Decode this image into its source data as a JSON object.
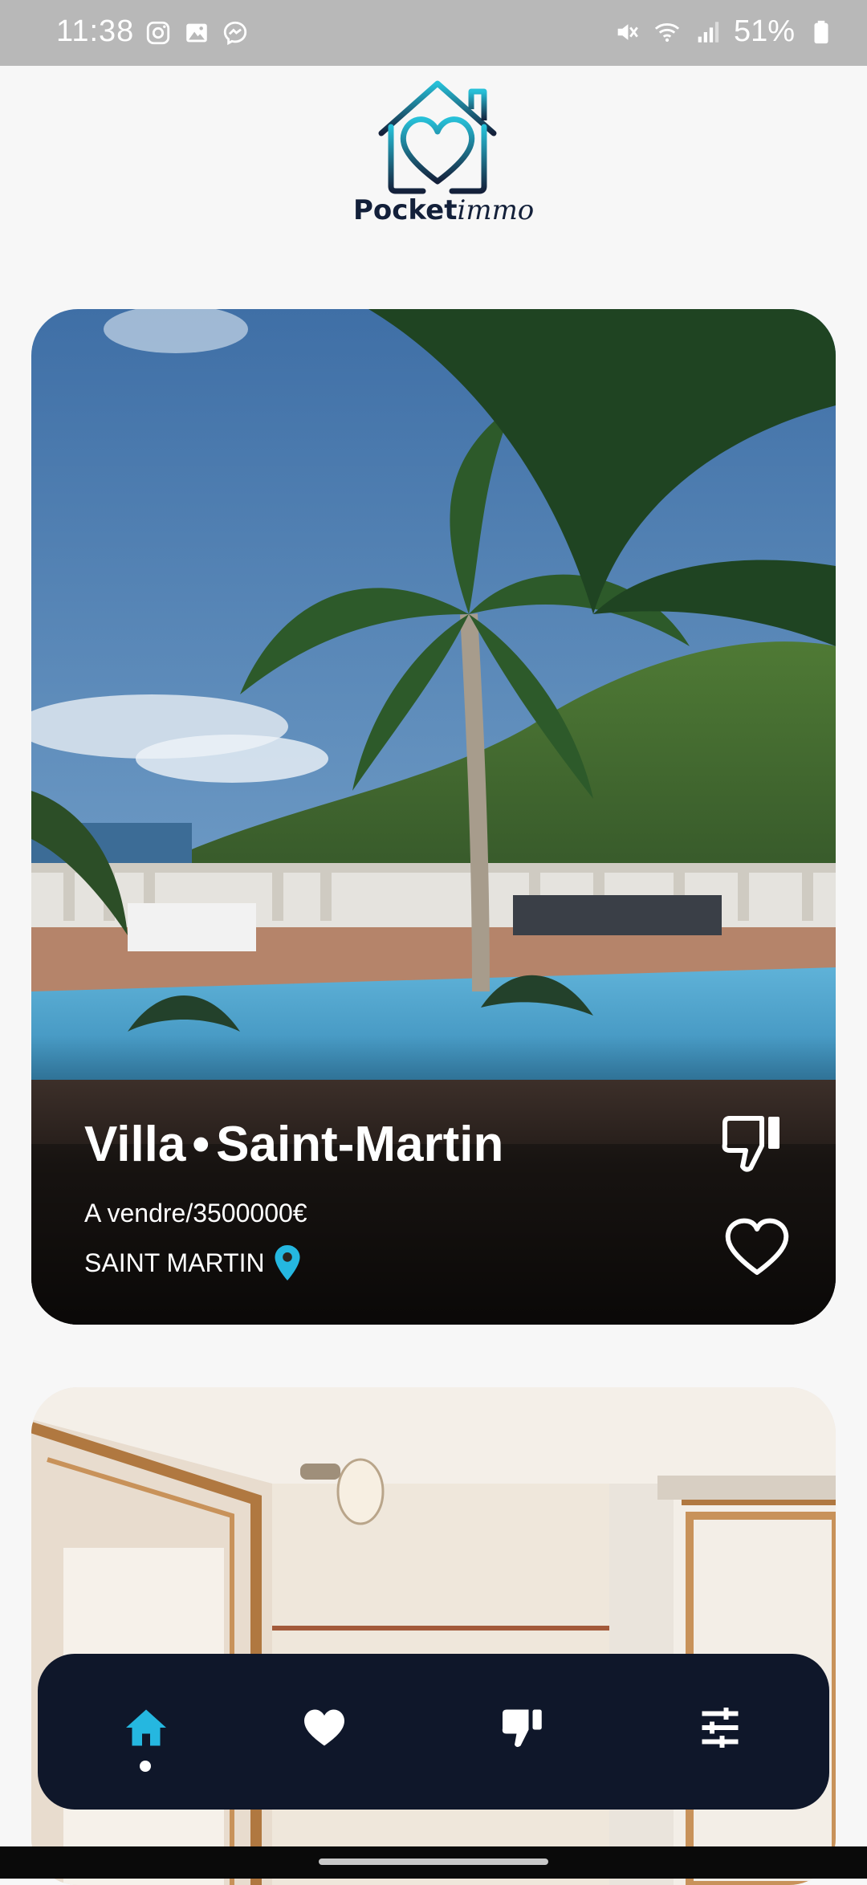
{
  "status_bar": {
    "time": "11:38",
    "battery": "51%",
    "left_icons": [
      "instagram-icon",
      "gallery-icon",
      "messenger-icon"
    ],
    "right_icons": [
      "mute-icon",
      "wifi-icon",
      "signal-icon",
      "battery-icon"
    ]
  },
  "logo": {
    "part1": "Pocket",
    "part2": "immo",
    "color": "#1fa9c7"
  },
  "listings": [
    {
      "type": "Villa",
      "separator": "•",
      "city": "Saint-Martin",
      "price": "A vendre/3500000€",
      "location": "SAINT MARTIN"
    }
  ],
  "bottom_nav": {
    "items": [
      "home-icon",
      "heart-icon",
      "thumbs-down-icon",
      "sliders-icon"
    ],
    "active": "home-icon",
    "active_color": "#25b7e0",
    "background": "#0f172a"
  },
  "colors": {
    "accent": "#25b7e0",
    "page_background": "#f7f7f7"
  }
}
